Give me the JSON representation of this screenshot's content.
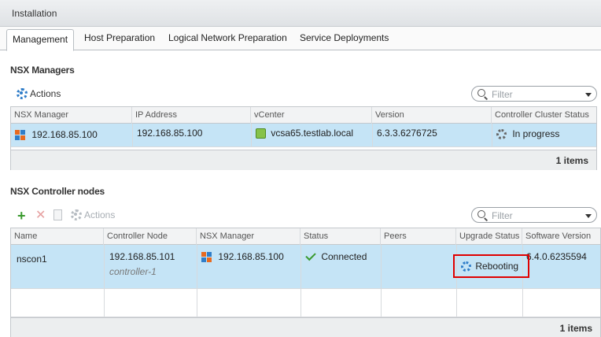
{
  "window": {
    "title": "Installation"
  },
  "tabs": [
    {
      "label": "Management"
    },
    {
      "label": "Host Preparation"
    },
    {
      "label": "Logical Network Preparation"
    },
    {
      "label": "Service Deployments"
    }
  ],
  "managers": {
    "title": "NSX Managers",
    "actions_label": "Actions",
    "filter_placeholder": "Filter",
    "columns": [
      "NSX Manager",
      "IP Address",
      "vCenter",
      "Version",
      "Controller Cluster Status"
    ],
    "row": {
      "nsx_manager": "192.168.85.100",
      "ip_address": "192.168.85.100",
      "vcenter": "vcsa65.testlab.local",
      "version": "6.3.3.6276725",
      "status": "In progress"
    },
    "count": "1 items"
  },
  "controllers": {
    "title": "NSX Controller nodes",
    "actions_label": "Actions",
    "filter_placeholder": "Filter",
    "columns": [
      "Name",
      "Controller Node",
      "NSX Manager",
      "Status",
      "Peers",
      "Upgrade Status",
      "Software Version"
    ],
    "row": {
      "name": "nscon1",
      "node_ip": "192.168.85.101",
      "node_name": "controller-1",
      "nsx_manager": "192.168.85.100",
      "status": "Connected",
      "peers": "",
      "upgrade_status": "Rebooting",
      "software_version": "6.4.0.6235594"
    },
    "count": "1 items"
  },
  "colors": {
    "selected_row": "#c5e4f6",
    "highlight_box": "#e00000",
    "accent": "#2e7cc8"
  }
}
